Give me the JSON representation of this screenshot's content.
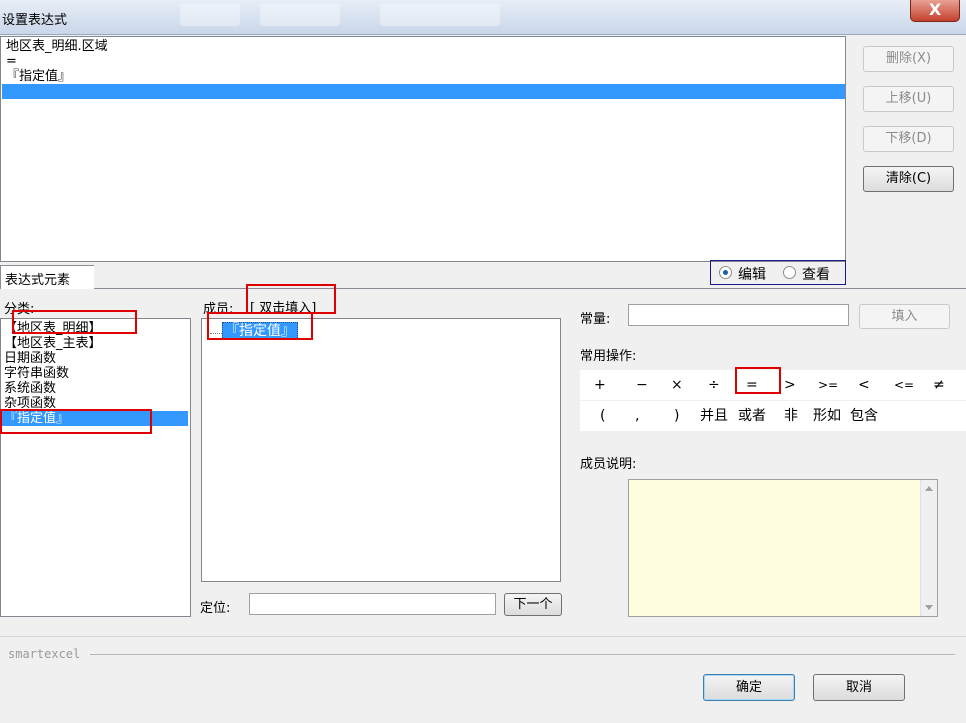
{
  "window": {
    "title": "设置表达式",
    "close_label": "X"
  },
  "expression": {
    "lines": [
      "地区表_明细.区域",
      "=",
      "『指定值』",
      ""
    ],
    "selected_index": 3
  },
  "side_buttons": {
    "delete": "删除(X)",
    "move_up": "上移(U)",
    "move_down": "下移(D)",
    "clear": "清除(C)"
  },
  "tab": {
    "label": "表达式元素"
  },
  "view_mode": {
    "edit": "编辑",
    "view": "查看",
    "selected": "edit"
  },
  "category": {
    "label": "分类:",
    "items": [
      "【地区表_明细】",
      "【地区表_主表】",
      "日期函数",
      "字符串函数",
      "系统函数",
      "杂项函数",
      "『指定值』"
    ],
    "selected_index": 6
  },
  "member": {
    "label": "成员:",
    "hint": "[ 双击填入]",
    "items": [
      "『指定值』"
    ]
  },
  "locate": {
    "label": "定位:",
    "value": "",
    "next_button": "下一个"
  },
  "constant": {
    "label": "常量:",
    "value": "",
    "fill_button": "填入"
  },
  "operations": {
    "label": "常用操作:",
    "row1": [
      "+",
      "−",
      "×",
      "÷",
      "=",
      ">",
      ">=",
      "<",
      "<=",
      "≠"
    ],
    "row2": [
      "(",
      ",",
      ")",
      "并且",
      "或者",
      "非",
      "形如",
      "包含"
    ]
  },
  "member_description": {
    "label": "成员说明:"
  },
  "footer": {
    "brand": "smartexcel",
    "ok": "确定",
    "cancel": "取消"
  }
}
